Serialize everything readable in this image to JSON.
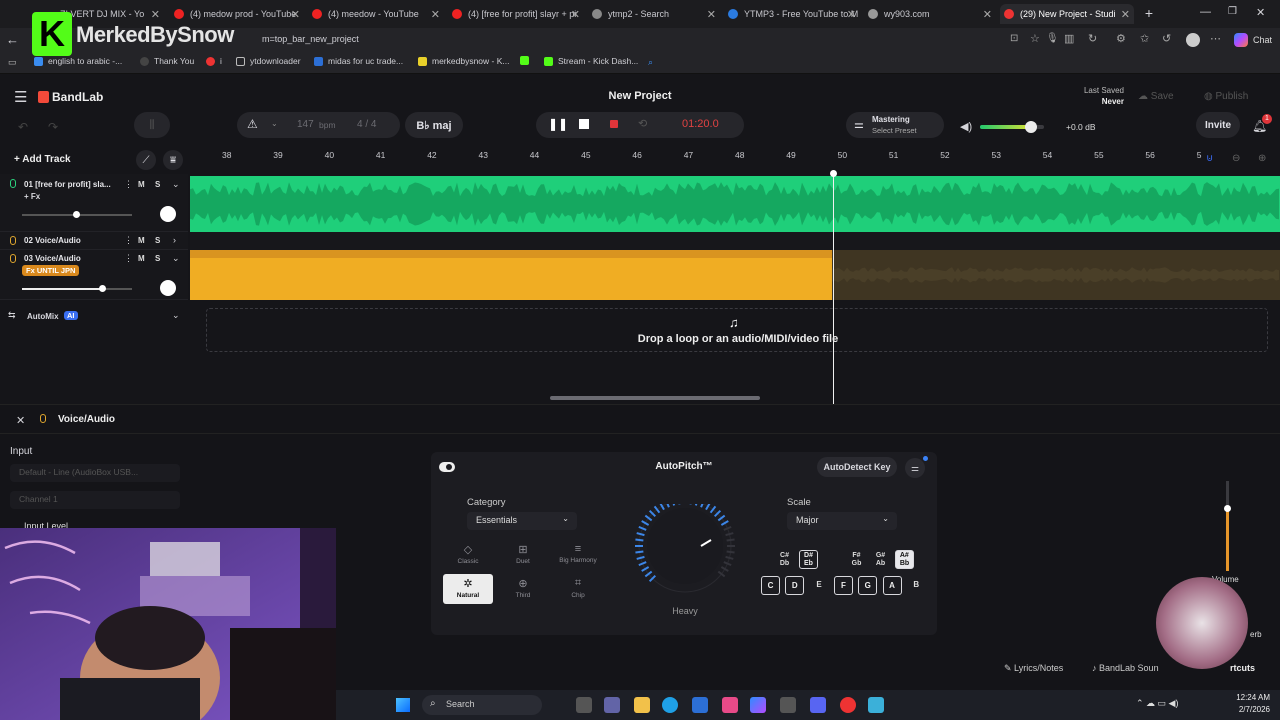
{
  "browser": {
    "tabs": [
      {
        "label": "ZI VERT DJ MIX - Yo"
      },
      {
        "label": "(4) medow prod - YouTube"
      },
      {
        "label": "(4) meedow - YouTube"
      },
      {
        "label": "(4) [free for profit] slayr + pi"
      },
      {
        "label": "ytmp2 - Search"
      },
      {
        "label": "YTMP3 - Free YouTube to M"
      },
      {
        "label": "wy903.com"
      },
      {
        "label": "(29) New Project - Studi"
      }
    ],
    "address": "m=top_bar_new_project",
    "bookmarks": [
      "english to arabic -...",
      "Thank You",
      "i",
      "ytdownloader",
      "midas for uc trade...",
      "merkedbysnow - K...",
      "",
      "Stream - Kick Dash..."
    ],
    "chat_label": "Chat"
  },
  "overlay": {
    "channel_name": "MerkedBySnow",
    "logo_letter": "K"
  },
  "app": {
    "brand": "BandLab",
    "project_title": "New Project",
    "last_saved_label": "Last Saved",
    "last_saved_value": "Never",
    "save_label": "Save",
    "publish_label": "Publish",
    "invite_label": "Invite",
    "notification_count": "1",
    "tempo_value": "147",
    "tempo_unit": "bpm",
    "time_signature": "4 / 4",
    "key": "B♭ maj",
    "time_display": "01:20.0",
    "mastering_label": "Mastering",
    "mastering_preset": "Select Preset",
    "volume_db": "+0.0 dB",
    "master_volume_level": 0.8,
    "add_track_label": "Add Track"
  },
  "ruler": {
    "bars": [
      "38",
      "39",
      "40",
      "41",
      "42",
      "43",
      "44",
      "45",
      "46",
      "47",
      "48",
      "49",
      "50",
      "51",
      "52",
      "53",
      "54",
      "55",
      "56",
      "5"
    ]
  },
  "tracks": [
    {
      "name": "01  [free for profit] sla...",
      "fx": "+ Fx",
      "mute": "M",
      "solo": "S"
    },
    {
      "name": "02  Voice/Audio",
      "mute": "M",
      "solo": "S"
    },
    {
      "name": "03  Voice/Audio",
      "fx": "Fx  UNTIL JPN",
      "mute": "M",
      "solo": "S"
    }
  ],
  "automix": {
    "label": "AutoMix",
    "badge": "AI"
  },
  "dropzone_text": "Drop a loop or an audio/MIDI/video file",
  "panel": {
    "title": "Voice/Audio",
    "input_label": "Input",
    "input_device": "Default - Line (AudioBox USB...",
    "channel": "Channel 1",
    "input_level_label": "Input Level",
    "lyrics_label": "Lyrics/Notes",
    "sounds_label": "BandLab Soun",
    "shortcuts_label": "rtcuts",
    "volume_label": "Volume",
    "reverb_label": "erb"
  },
  "autopitch": {
    "title": "AutoPitch™",
    "autodetect_label": "AutoDetect Key",
    "category_label": "Category",
    "category_value": "Essentials",
    "scale_label": "Scale",
    "scale_value": "Major",
    "knob_label": "Heavy",
    "styles": [
      {
        "name": "Classic",
        "icon": "◇"
      },
      {
        "name": "Duet",
        "icon": "⊞"
      },
      {
        "name": "Big Harmony",
        "icon": "≡"
      },
      {
        "name": "Natural",
        "icon": "✲"
      },
      {
        "name": "Third",
        "icon": "⊕"
      },
      {
        "name": "Chip",
        "icon": "⌗"
      }
    ],
    "sharps": [
      "C#\nDb",
      "D#\nEb",
      "F#\nGb",
      "G#\nAb",
      "A#\nBb"
    ],
    "naturals": [
      "C",
      "D",
      "E",
      "F",
      "G",
      "A",
      "B"
    ]
  },
  "taskbar": {
    "search_label": "Search",
    "time": "12:24 AM",
    "date": "2/7/2026"
  }
}
